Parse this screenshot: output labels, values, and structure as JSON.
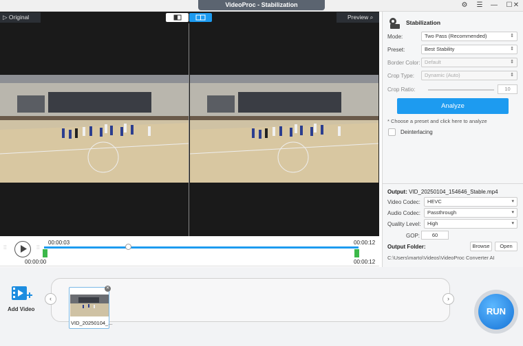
{
  "window": {
    "title": "VideoProc - Stabilization"
  },
  "preview": {
    "original_label": "Original",
    "preview_label": "Preview"
  },
  "timeline": {
    "current_time": "00:00:03",
    "start_time": "00:00:00",
    "end_time_top": "00:00:12",
    "end_time_bottom": "00:00:12",
    "playhead_fraction": 0.27
  },
  "panel": {
    "title": "Stabilization",
    "mode": {
      "label": "Mode:",
      "value": "Two Pass (Recommended)"
    },
    "preset": {
      "label": "Preset:",
      "value": "Best Stability"
    },
    "border_color": {
      "label": "Border Color:",
      "value": "Default"
    },
    "crop_type": {
      "label": "Crop Type:",
      "value": "Dynamic (Auto)"
    },
    "crop_ratio": {
      "label": "Crop Ratio:",
      "value": "10"
    },
    "analyze_label": "Analyze",
    "hint": "* Choose a preset and click here to analyze",
    "deinterlacing_label": "Deinterlacing",
    "output": {
      "label": "Output:",
      "filename": "VID_20250104_154646_Stable.mp4"
    },
    "video_codec": {
      "label": "Video Codec:",
      "value": "HEVC"
    },
    "audio_codec": {
      "label": "Audio Codec:",
      "value": "Passthrough"
    },
    "quality": {
      "label": "Quality Level:",
      "value": "High"
    },
    "gop": {
      "label": "GOP:",
      "value": "60"
    },
    "output_folder_label": "Output Folder:",
    "browse_label": "Browse",
    "open_label": "Open",
    "folder_path": "C:\\Users\\marto\\Videos\\VideoProc Converter AI"
  },
  "bottom": {
    "add_video_label": "Add Video",
    "clip_name": "VID_20250104_...",
    "run_label": "RUN"
  },
  "colors": {
    "accent": "#1d9bf0",
    "handle_green": "#3cb84a"
  }
}
